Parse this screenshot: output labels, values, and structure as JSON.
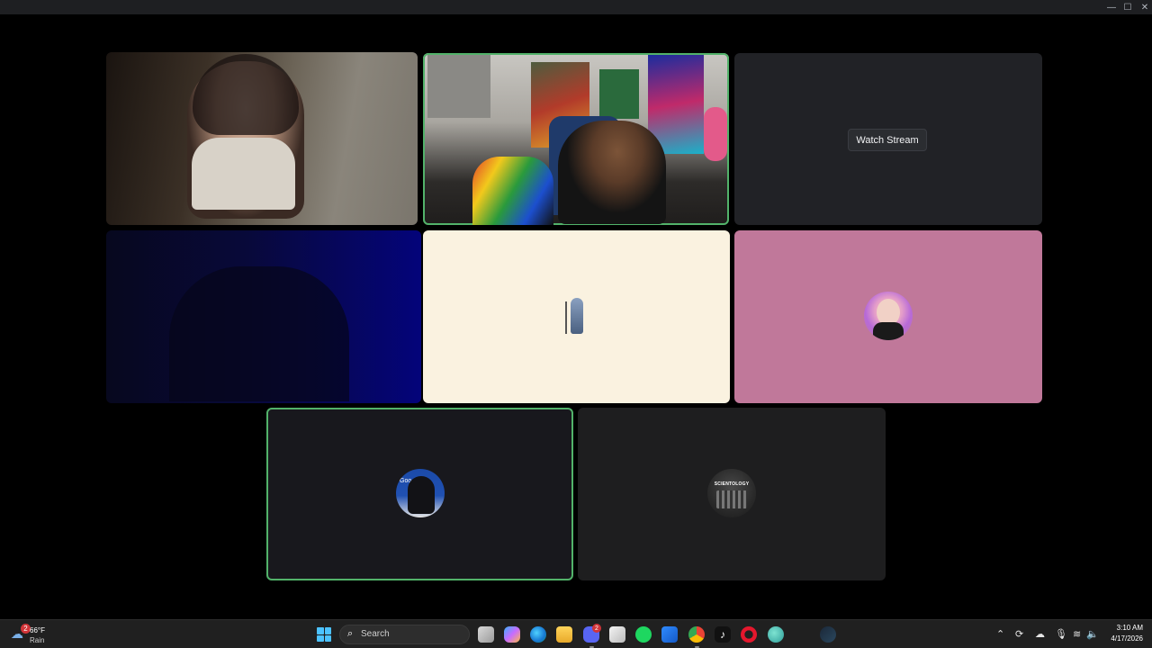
{
  "window": {
    "controls": {
      "minimize": "—",
      "maximize": "☐",
      "close": "✕"
    }
  },
  "stage": {
    "screen_share_tile": {
      "watch_label": "Watch Stream"
    },
    "avatar_tiles": [
      {
        "name": "statue-avatar"
      },
      {
        "name": "pink-avatar"
      },
      {
        "name": "hooded-avatar",
        "overlay_text": "Goo"
      },
      {
        "name": "building-avatar",
        "overlay_text": "SCIENTOLOGY"
      }
    ],
    "speaking_color": "#52b26a"
  },
  "taskbar": {
    "weather": {
      "temp": "66°F",
      "condition": "Rain",
      "badge": "2"
    },
    "search": {
      "placeholder": "Search"
    },
    "apps": [
      "task-view",
      "copilot",
      "edge",
      "file-explorer",
      "discord",
      "microsoft-store",
      "spotify",
      "mail",
      "chrome",
      "tiktok",
      "opera",
      "globe-app",
      "steam"
    ],
    "discord_badge": "2",
    "clock": {
      "time": "3:10 AM",
      "date": "4/17/2026"
    }
  }
}
